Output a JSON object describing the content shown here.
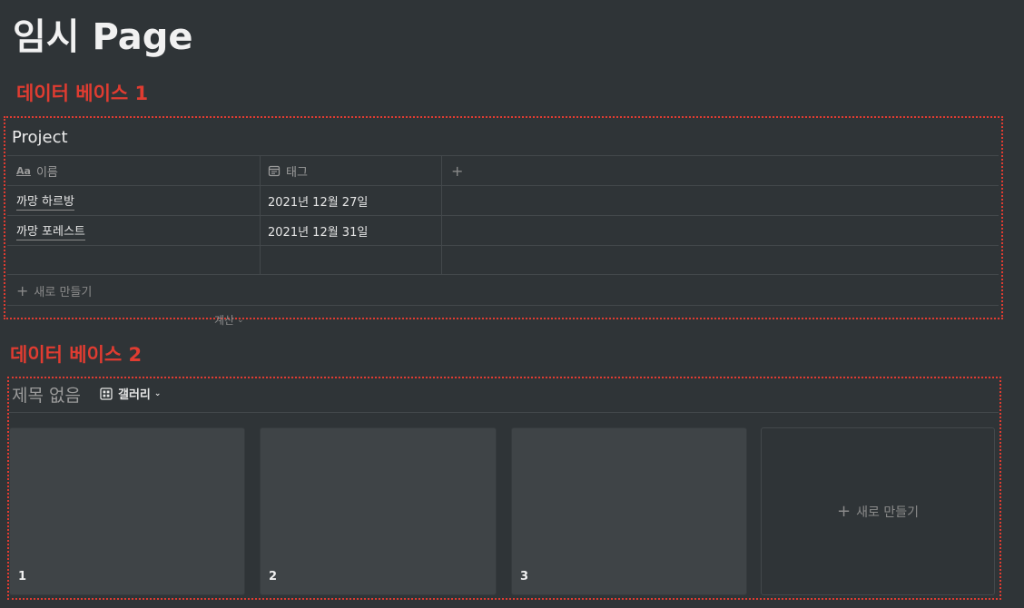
{
  "page": {
    "title": "임시 Page"
  },
  "annotations": [
    {
      "label": "데이터 베이스 1"
    },
    {
      "label": "데이터 베이스 2"
    }
  ],
  "database1": {
    "title": "Project",
    "columns": [
      {
        "icon": "text-icon",
        "icon_text": "Aa",
        "label": "이름"
      },
      {
        "icon": "calendar-icon",
        "label": "태그"
      }
    ],
    "add_column": "+",
    "rows": [
      {
        "name": "까망 하르방",
        "date": "2021년 12월 27일"
      },
      {
        "name": "까망 포레스트",
        "date": "2021년 12월 31일"
      }
    ],
    "new_row_label": "새로 만들기",
    "calc_label": "계산"
  },
  "database2": {
    "title": "제목 없음",
    "view_label": "갤러리",
    "cards": [
      {
        "label": "1"
      },
      {
        "label": "2"
      },
      {
        "label": "3"
      }
    ],
    "new_card_label": "새로 만들기"
  },
  "colors": {
    "background": "#2f3437",
    "annotation": "#e03c31",
    "card": "#3f4447"
  }
}
